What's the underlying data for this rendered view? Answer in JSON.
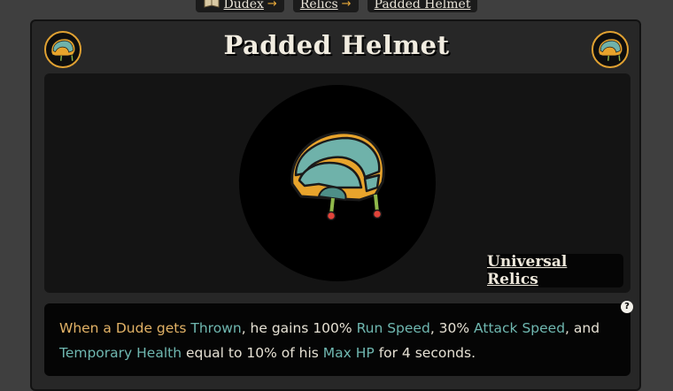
{
  "breadcrumb": {
    "items": [
      {
        "label": "Dudex",
        "icon": "book-icon"
      },
      {
        "label": "Relics"
      },
      {
        "label": "Padded Helmet"
      }
    ],
    "separator": "→"
  },
  "relic": {
    "name": "Padded Helmet",
    "category": "Universal Relics",
    "icon": "padded-helmet-icon",
    "description": {
      "parts": [
        {
          "text": "When a Dude gets ",
          "style": "gold"
        },
        {
          "text": "Thrown",
          "style": "teal"
        },
        {
          "text": ", he gains 100% ",
          "style": "plain"
        },
        {
          "text": "Run Speed",
          "style": "teal"
        },
        {
          "text": ", 30% ",
          "style": "plain"
        },
        {
          "text": "Attack Speed",
          "style": "teal"
        },
        {
          "text": ", and ",
          "style": "plain"
        },
        {
          "text": "Temporary Health",
          "style": "teal"
        },
        {
          "text": " equal to 10% of his ",
          "style": "plain"
        },
        {
          "text": "Max HP",
          "style": "teal"
        },
        {
          "text": " for 4 seconds.",
          "style": "plain"
        }
      ]
    },
    "help_label": "?"
  },
  "colors": {
    "background": "#3f3f3f",
    "panel": "#272727",
    "accent_gold": "#e0a132",
    "keyword_teal": "#6fb7b0",
    "text_gold": "#e2b266",
    "helmet_shell": "#6fb2aa",
    "helmet_trim": "#e8a42c"
  }
}
